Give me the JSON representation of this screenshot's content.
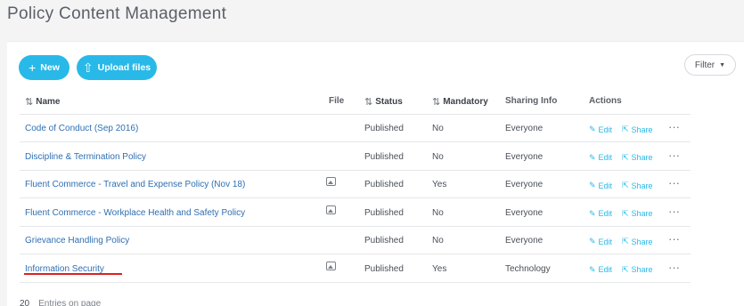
{
  "page_title": "Policy Content Management",
  "toolbar": {
    "new_label": "New",
    "upload_label": "Upload files",
    "filter_label": "Filter"
  },
  "table": {
    "headers": {
      "name": "Name",
      "file": "File",
      "status": "Status",
      "mandatory": "Mandatory",
      "sharing": "Sharing Info",
      "actions": "Actions"
    },
    "rows": [
      {
        "name": "Code of Conduct (Sep 2016)",
        "has_file": false,
        "status": "Published",
        "mandatory": "No",
        "sharing": "Everyone",
        "edit": "Edit",
        "share": "Share",
        "more": "···"
      },
      {
        "name": "Discipline & Termination Policy",
        "has_file": false,
        "status": "Published",
        "mandatory": "No",
        "sharing": "Everyone",
        "edit": "Edit",
        "share": "Share",
        "more": "···"
      },
      {
        "name": "Fluent Commerce - Travel and Expense Policy (Nov 18)",
        "has_file": true,
        "status": "Published",
        "mandatory": "Yes",
        "sharing": "Everyone",
        "edit": "Edit",
        "share": "Share",
        "more": "···"
      },
      {
        "name": "Fluent Commerce - Workplace Health and Safety Policy",
        "has_file": true,
        "status": "Published",
        "mandatory": "No",
        "sharing": "Everyone",
        "edit": "Edit",
        "share": "Share",
        "more": "···"
      },
      {
        "name": "Grievance Handling Policy",
        "has_file": false,
        "status": "Published",
        "mandatory": "No",
        "sharing": "Everyone",
        "edit": "Edit",
        "share": "Share",
        "more": "···"
      },
      {
        "name": "Information Security",
        "has_file": true,
        "status": "Published",
        "mandatory": "Yes",
        "sharing": "Technology",
        "edit": "Edit",
        "share": "Share",
        "more": "···"
      }
    ]
  },
  "footer": {
    "per_page": "20",
    "label": "Entries on page"
  },
  "colors": {
    "accent": "#28b9e8",
    "link": "#2e6fb3",
    "highlight": "#e02020"
  }
}
